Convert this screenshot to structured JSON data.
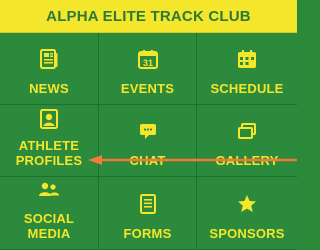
{
  "app": {
    "title": "ALPHA ELITE TRACK CLUB",
    "colors": {
      "header_bg": "#f4e62a",
      "header_text": "#2c7a37",
      "tile_bg": "#2c8a3c",
      "tile_text": "#f4e62a",
      "grid_line": "#1f6f2d",
      "arrow": "#f07a3a"
    }
  },
  "tiles": [
    {
      "label": "NEWS",
      "icon": "news-icon"
    },
    {
      "label": "EVENTS",
      "icon": "calendar-31-icon"
    },
    {
      "label": "SCHEDULE",
      "icon": "calendar-grid-icon"
    },
    {
      "label": "ATHLETE\nPROFILES",
      "icon": "profile-card-icon"
    },
    {
      "label": "CHAT",
      "icon": "chat-bubble-icon"
    },
    {
      "label": "GALLERY",
      "icon": "gallery-icon"
    },
    {
      "label": "SOCIAL MEDIA",
      "icon": "people-icon"
    },
    {
      "label": "FORMS",
      "icon": "document-icon"
    },
    {
      "label": "SPONSORS",
      "icon": "star-icon"
    }
  ],
  "annotation": {
    "arrow_icon": "left-arrow-annotation"
  }
}
